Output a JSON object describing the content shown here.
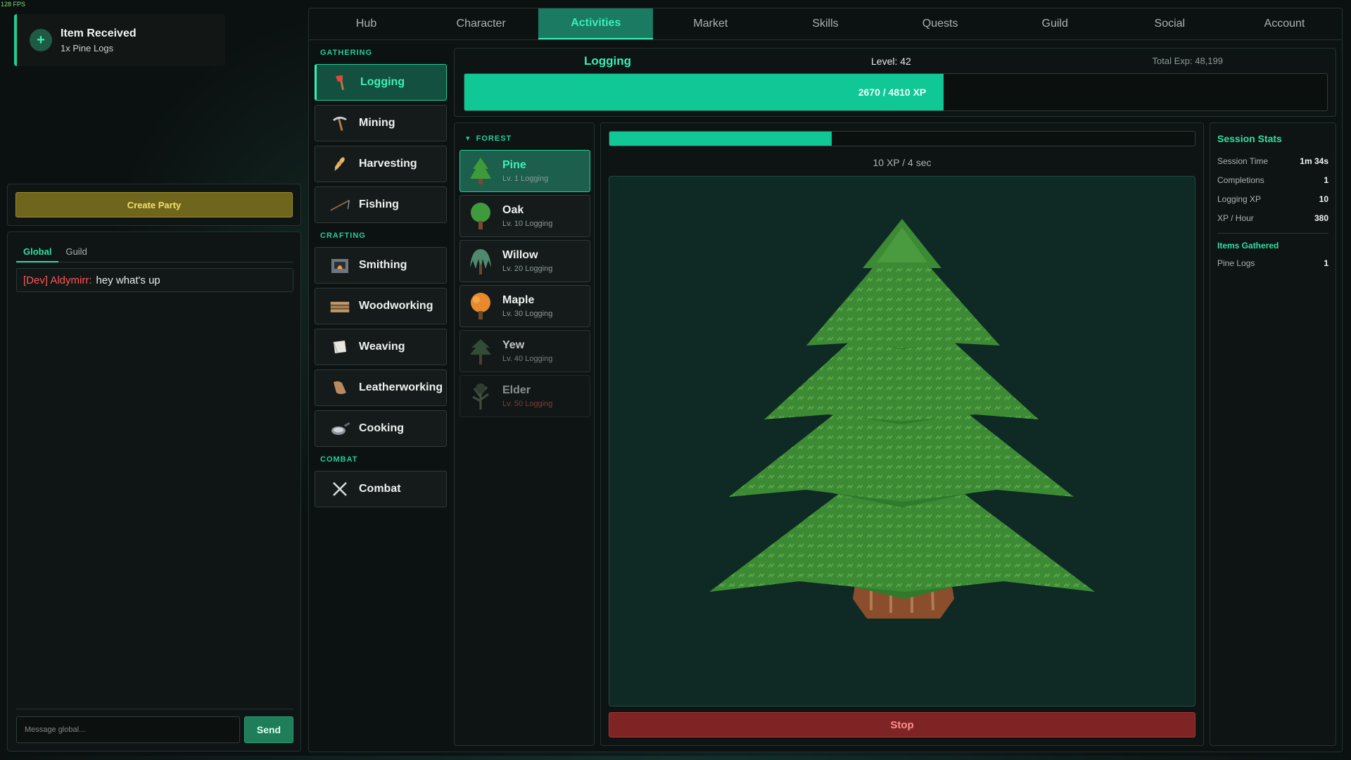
{
  "fps": "128 FPS",
  "toast": {
    "title": "Item Received",
    "message": "1x Pine Logs",
    "icon": "plus-icon"
  },
  "party": {
    "create_label": "Create Party"
  },
  "chat": {
    "tabs": [
      {
        "label": "Global",
        "active": true
      },
      {
        "label": "Guild",
        "active": false
      }
    ],
    "messages": [
      {
        "author": "[Dev] Aldymirr:",
        "text": "hey what's up"
      }
    ],
    "input_placeholder": "Message global...",
    "send_label": "Send"
  },
  "nav": {
    "tabs": [
      "Hub",
      "Character",
      "Activities",
      "Market",
      "Skills",
      "Quests",
      "Guild",
      "Social",
      "Account"
    ],
    "active": "Activities"
  },
  "skills": {
    "gathering_label": "GATHERING",
    "crafting_label": "CRAFTING",
    "combat_label": "COMBAT",
    "gathering": [
      {
        "label": "Logging",
        "icon": "axe-icon",
        "active": true
      },
      {
        "label": "Mining",
        "icon": "pickaxe-icon"
      },
      {
        "label": "Harvesting",
        "icon": "wheat-icon"
      },
      {
        "label": "Fishing",
        "icon": "fishing-rod-icon"
      }
    ],
    "crafting": [
      {
        "label": "Smithing",
        "icon": "forge-icon"
      },
      {
        "label": "Woodworking",
        "icon": "planks-icon"
      },
      {
        "label": "Weaving",
        "icon": "cloth-icon"
      },
      {
        "label": "Leatherworking",
        "icon": "leather-icon"
      },
      {
        "label": "Cooking",
        "icon": "pan-icon"
      }
    ],
    "combat": [
      {
        "label": "Combat",
        "icon": "crossed-swords-icon"
      }
    ]
  },
  "skill_header": {
    "name": "Logging",
    "level": "Level: 42",
    "total": "Total Exp: 48,199",
    "xp_text": "2670 / 4810 XP",
    "xp_current": 2670,
    "xp_needed": 4810
  },
  "resources": {
    "category": "FOREST",
    "items": [
      {
        "name": "Pine",
        "req": "Lv. 1 Logging",
        "state": "active",
        "color": "#3f9a3a"
      },
      {
        "name": "Oak",
        "req": "Lv. 10 Logging",
        "state": "unlocked",
        "color": "#3e9a3c"
      },
      {
        "name": "Willow",
        "req": "Lv. 20 Logging",
        "state": "unlocked",
        "color": "#4f8a6f"
      },
      {
        "name": "Maple",
        "req": "Lv. 30 Logging",
        "state": "unlocked",
        "color": "#e8892c"
      },
      {
        "name": "Yew",
        "req": "Lv. 40 Logging",
        "state": "unlocked",
        "color": "#3a5a40"
      },
      {
        "name": "Elder",
        "req": "Lv. 50 Logging",
        "state": "locked",
        "color": "#5a6a55"
      }
    ]
  },
  "activity": {
    "progress": 0.38,
    "rate": "10 XP / 4 sec",
    "stop_label": "Stop"
  },
  "stats": {
    "title": "Session Stats",
    "rows": [
      {
        "label": "Session Time",
        "value": "1m 34s"
      },
      {
        "label": "Completions",
        "value": "1"
      },
      {
        "label": "Logging XP",
        "value": "10"
      },
      {
        "label": "XP / Hour",
        "value": "380"
      }
    ],
    "items_title": "Items Gathered",
    "items": [
      {
        "label": "Pine Logs",
        "value": "1"
      }
    ]
  }
}
